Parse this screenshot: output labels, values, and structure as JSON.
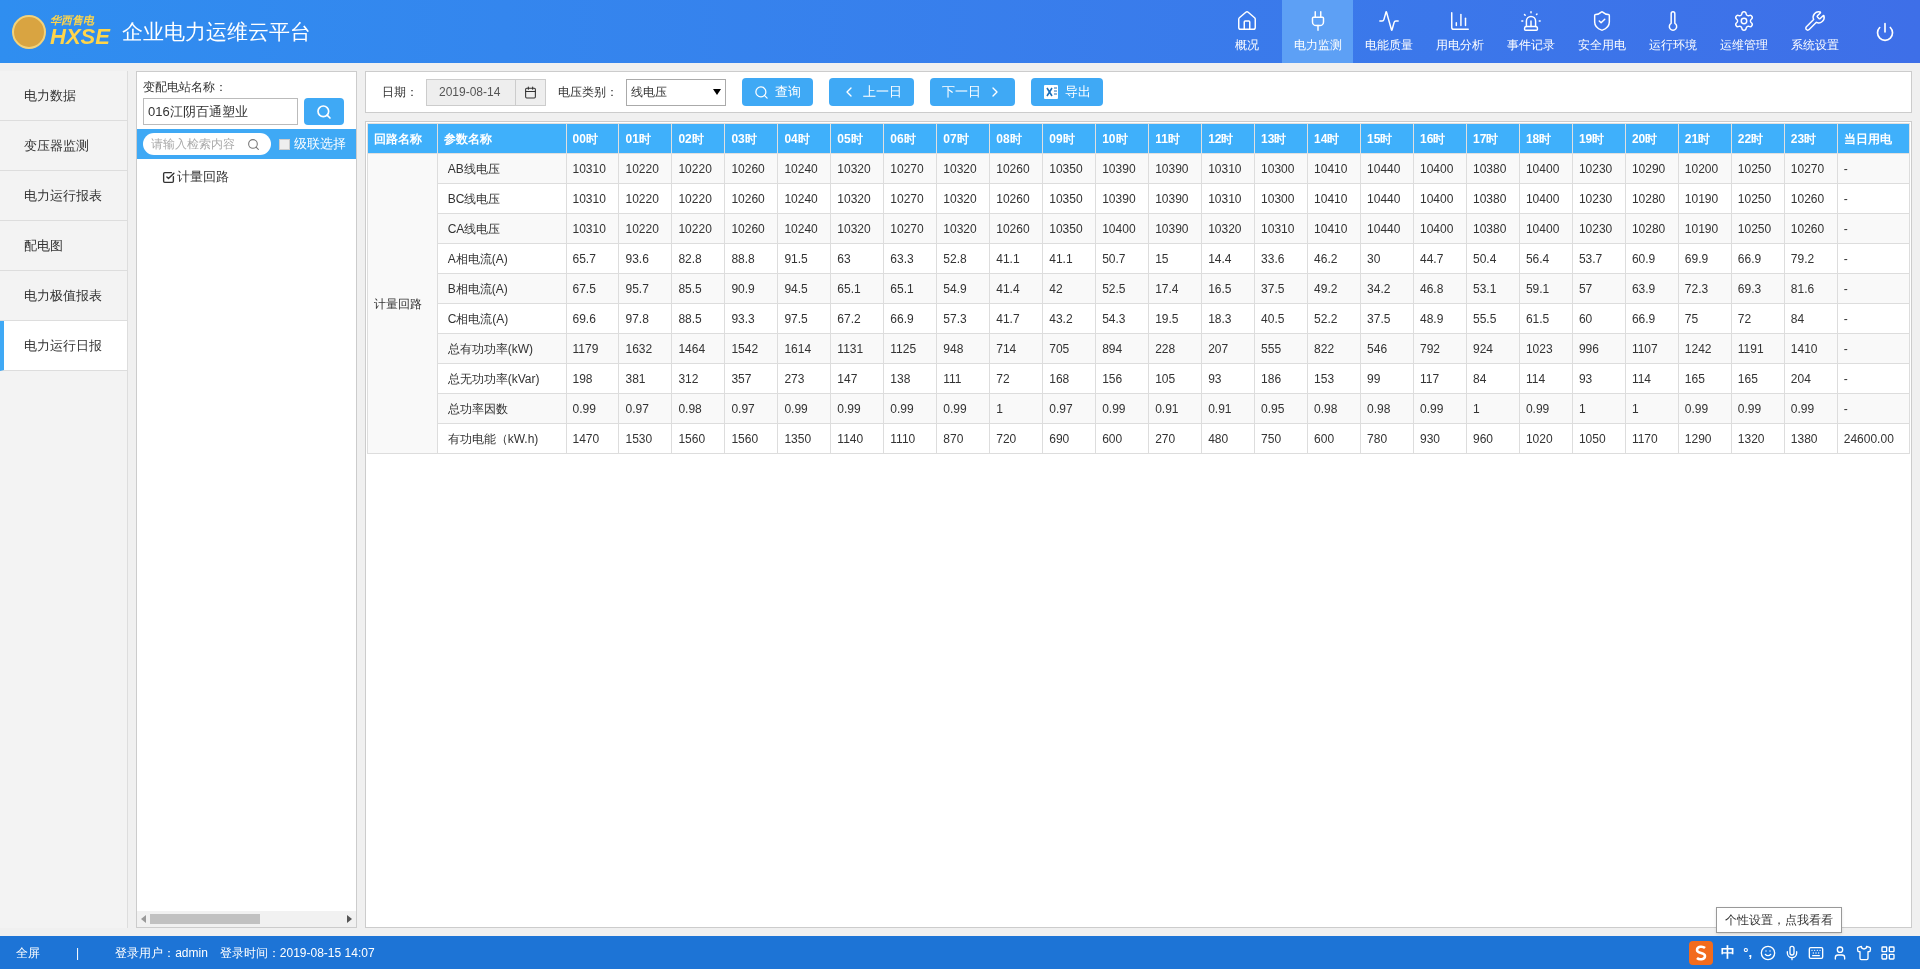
{
  "header": {
    "logo_top": "华西售电",
    "logo_text": "HXSE",
    "title": "企业电力运维云平台",
    "nav": [
      {
        "label": "概况",
        "selected": false
      },
      {
        "label": "电力监测",
        "selected": true
      },
      {
        "label": "电能质量",
        "selected": false
      },
      {
        "label": "用电分析",
        "selected": false
      },
      {
        "label": "事件记录",
        "selected": false
      },
      {
        "label": "安全用电",
        "selected": false
      },
      {
        "label": "运行环境",
        "selected": false
      },
      {
        "label": "运维管理",
        "selected": false
      },
      {
        "label": "系统设置",
        "selected": false
      }
    ]
  },
  "sidebar": {
    "items": [
      {
        "label": "电力数据",
        "selected": false
      },
      {
        "label": "变压器监测",
        "selected": false
      },
      {
        "label": "电力运行报表",
        "selected": false
      },
      {
        "label": "配电图",
        "selected": false
      },
      {
        "label": "电力极值报表",
        "selected": false
      },
      {
        "label": "电力运行日报",
        "selected": true
      }
    ]
  },
  "station_panel": {
    "label": "变配电站名称：",
    "value": "016江阴百通塑业",
    "search_placeholder": "请输入检索内容",
    "cascade": {
      "label": "级联选择",
      "checked": false
    },
    "tree": [
      {
        "label": "计量回路",
        "checked": true
      }
    ]
  },
  "toolbar": {
    "date_label": "日期：",
    "date": "2019-08-14",
    "voltage_label": "电压类别：",
    "voltage": "线电压",
    "buttons": [
      "查询",
      "上一日",
      "下一日",
      "导出"
    ]
  },
  "table": {
    "columns": [
      "回路名称",
      "参数名称",
      "00时",
      "01时",
      "02时",
      "03时",
      "04时",
      "05时",
      "06时",
      "07时",
      "08时",
      "09时",
      "10时",
      "11时",
      "12时",
      "13时",
      "14时",
      "15时",
      "16时",
      "17时",
      "18时",
      "19时",
      "20时",
      "21时",
      "22时",
      "23时",
      "当日用电"
    ],
    "rows": [
      {
        "cells": [
          {
            "text": "计量回路",
            "rowspan": 10
          },
          "AB线电压",
          "10310",
          "10220",
          "10220",
          "10260",
          "10240",
          "10320",
          "10270",
          "10320",
          "10260",
          "10350",
          "10390",
          "10390",
          "10310",
          "10300",
          "10410",
          "10440",
          "10400",
          "10380",
          "10400",
          "10230",
          "10290",
          "10200",
          "10250",
          "10270",
          "-"
        ]
      },
      {
        "cells": [
          "BC线电压",
          "10310",
          "10220",
          "10220",
          "10260",
          "10240",
          "10320",
          "10270",
          "10320",
          "10260",
          "10350",
          "10390",
          "10390",
          "10310",
          "10300",
          "10410",
          "10440",
          "10400",
          "10380",
          "10400",
          "10230",
          "10280",
          "10190",
          "10250",
          "10260",
          "-"
        ]
      },
      {
        "cells": [
          "CA线电压",
          "10310",
          "10220",
          "10220",
          "10260",
          "10240",
          "10320",
          "10270",
          "10320",
          "10260",
          "10350",
          "10400",
          "10390",
          "10320",
          "10310",
          "10410",
          "10440",
          "10400",
          "10380",
          "10400",
          "10230",
          "10280",
          "10190",
          "10250",
          "10260",
          "-"
        ]
      },
      {
        "cells": [
          "A相电流(A)",
          "65.7",
          "93.6",
          "82.8",
          "88.8",
          "91.5",
          "63",
          "63.3",
          "52.8",
          "41.1",
          "41.1",
          "50.7",
          "15",
          "14.4",
          "33.6",
          "46.2",
          "30",
          "44.7",
          "50.4",
          "56.4",
          "53.7",
          "60.9",
          "69.9",
          "66.9",
          "79.2",
          "-"
        ]
      },
      {
        "cells": [
          "B相电流(A)",
          "67.5",
          "95.7",
          "85.5",
          "90.9",
          "94.5",
          "65.1",
          "65.1",
          "54.9",
          "41.4",
          "42",
          "52.5",
          "17.4",
          "16.5",
          "37.5",
          "49.2",
          "34.2",
          "46.8",
          "53.1",
          "59.1",
          "57",
          "63.9",
          "72.3",
          "69.3",
          "81.6",
          "-"
        ]
      },
      {
        "cells": [
          "C相电流(A)",
          "69.6",
          "97.8",
          "88.5",
          "93.3",
          "97.5",
          "67.2",
          "66.9",
          "57.3",
          "41.7",
          "43.2",
          "54.3",
          "19.5",
          "18.3",
          "40.5",
          "52.2",
          "37.5",
          "48.9",
          "55.5",
          "61.5",
          "60",
          "66.9",
          "75",
          "72",
          "84",
          "-"
        ]
      },
      {
        "cells": [
          "总有功功率(kW)",
          "1179",
          "1632",
          "1464",
          "1542",
          "1614",
          "1131",
          "1125",
          "948",
          "714",
          "705",
          "894",
          "228",
          "207",
          "555",
          "822",
          "546",
          "792",
          "924",
          "1023",
          "996",
          "1107",
          "1242",
          "1191",
          "1410",
          "-"
        ]
      },
      {
        "cells": [
          "总无功功率(kVar)",
          "198",
          "381",
          "312",
          "357",
          "273",
          "147",
          "138",
          "111",
          "72",
          "168",
          "156",
          "105",
          "93",
          "186",
          "153",
          "99",
          "117",
          "84",
          "114",
          "93",
          "114",
          "165",
          "165",
          "204",
          "-"
        ]
      },
      {
        "cells": [
          "总功率因数",
          "0.99",
          "0.97",
          "0.98",
          "0.97",
          "0.99",
          "0.99",
          "0.99",
          "0.99",
          "1",
          "0.97",
          "0.99",
          "0.91",
          "0.91",
          "0.95",
          "0.98",
          "0.98",
          "0.99",
          "1",
          "0.99",
          "1",
          "1",
          "0.99",
          "0.99",
          "0.99",
          "-"
        ]
      },
      {
        "cells": [
          "有功电能（kW.h)",
          "1470",
          "1530",
          "1560",
          "1560",
          "1350",
          "1140",
          "1110",
          "870",
          "720",
          "690",
          "600",
          "270",
          "480",
          "750",
          "600",
          "780",
          "930",
          "960",
          "1020",
          "1050",
          "1170",
          "1290",
          "1320",
          "1380",
          "24600.00"
        ]
      }
    ]
  },
  "status_bar": {
    "fullscreen": "全屏",
    "separator": "|",
    "user": "登录用户：admin",
    "login_time": "登录时间：2019-08-15 14:07"
  },
  "ime": {
    "tooltip": "个性设置，点我看看",
    "lang": "中",
    "punct": "°,"
  }
}
